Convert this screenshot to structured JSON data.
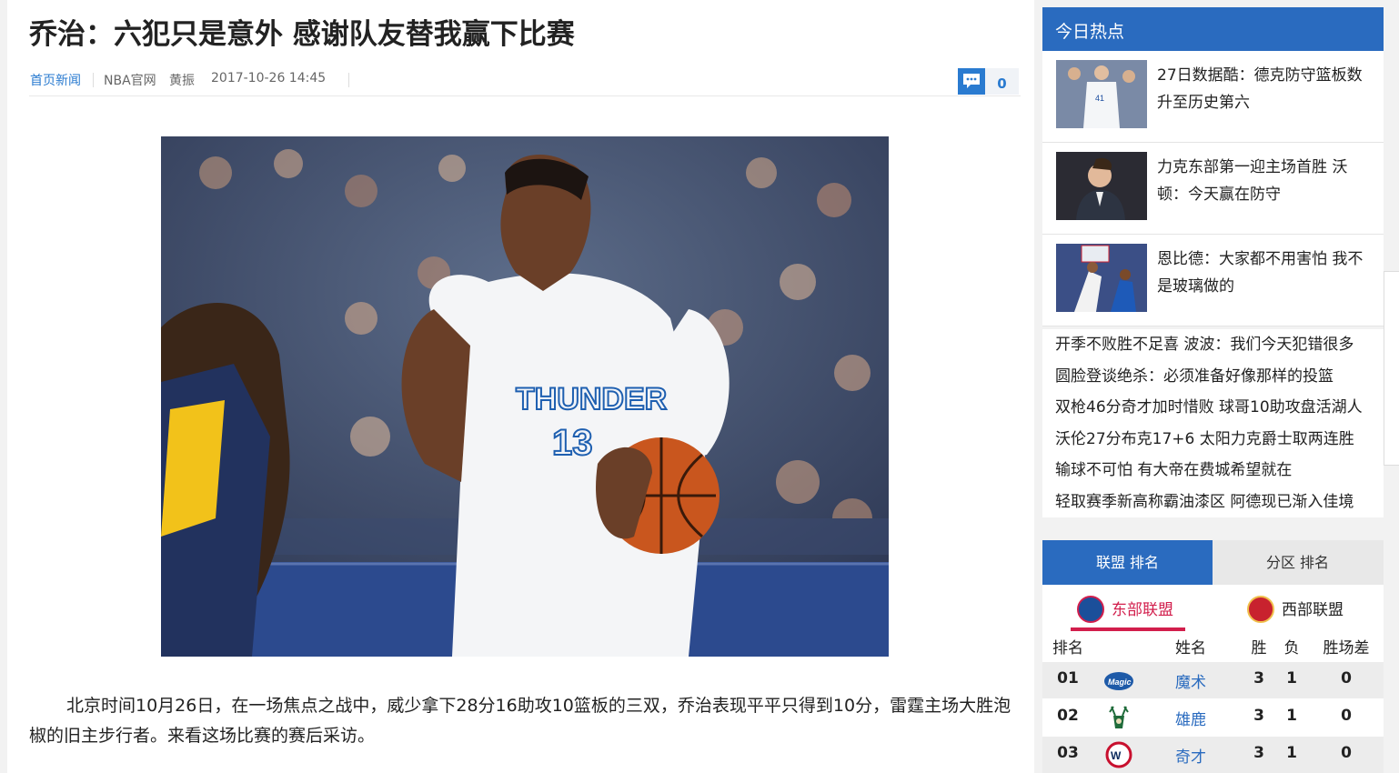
{
  "article": {
    "title": "乔治：六犯只是意外 感谢队友替我赢下比赛",
    "category": "首页新闻",
    "source": "NBA官网",
    "author": "黄振",
    "datetime": "2017-10-26 14:45",
    "comment_count": "0",
    "body": "北京时间10月26日，在一场焦点之战中，威少拿下28分16助攻10篮板的三双，乔治表现平平只得到10分，雷霆主场大胜泡椒的旧主步行者。来看这场比赛的赛后采访。"
  },
  "photo": {
    "jersey_text": "THUNDER",
    "jersey_number": "13"
  },
  "sidebar": {
    "hot_title": "今日热点",
    "hot_items": [
      {
        "title": "27日数据酷：德克防守篮板数升至历史第六"
      },
      {
        "title": "力克东部第一迎主场首胜 沃顿：今天赢在防守"
      },
      {
        "title": "恩比德：大家都不用害怕 我不是玻璃做的"
      }
    ],
    "hot_links": [
      "开季不败胜不足喜 波波：我们今天犯错很多",
      "圆脸登谈绝杀：必须准备好像那样的投篮",
      "双枪46分奇才加时惜败 球哥10助攻盘活湖人",
      "沃伦27分布克17+6 太阳力克爵士取两连胜",
      "输球不可怕 有大帝在费城希望就在",
      "轻取赛季新高称霸油漆区 阿德现已渐入佳境"
    ],
    "standings": {
      "tabs": [
        "联盟 排名",
        "分区 排名"
      ],
      "conferences": [
        "东部联盟",
        "西部联盟"
      ],
      "columns": {
        "rank": "排名",
        "name": "姓名",
        "wins": "胜",
        "losses": "负",
        "gb": "胜场差"
      },
      "rows": [
        {
          "rank": "01",
          "team": "魔术",
          "w": "3",
          "l": "1",
          "gb": "0"
        },
        {
          "rank": "02",
          "team": "雄鹿",
          "w": "3",
          "l": "1",
          "gb": "0"
        },
        {
          "rank": "03",
          "team": "奇才",
          "w": "3",
          "l": "1",
          "gb": "0"
        }
      ]
    }
  }
}
